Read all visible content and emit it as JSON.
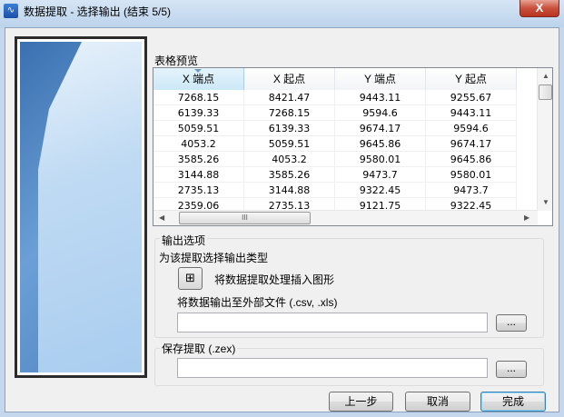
{
  "window": {
    "title": "数据提取 - 选择输出 (结束 5/5)",
    "close_label": "X"
  },
  "table_preview": {
    "label": "表格预览",
    "columns": [
      "X 端点",
      "X 起点",
      "Y 端点",
      "Y 起点"
    ],
    "rows": [
      [
        "7268.15",
        "8421.47",
        "9443.11",
        "9255.67"
      ],
      [
        "6139.33",
        "7268.15",
        "9594.6",
        "9443.11"
      ],
      [
        "5059.51",
        "6139.33",
        "9674.17",
        "9594.6"
      ],
      [
        "4053.2",
        "5059.51",
        "9645.86",
        "9674.17"
      ],
      [
        "3585.26",
        "4053.2",
        "9580.01",
        "9645.86"
      ],
      [
        "3144.88",
        "3585.26",
        "9473.7",
        "9580.01"
      ],
      [
        "2735.13",
        "3144.88",
        "9322.45",
        "9473.7"
      ],
      [
        "2359.06",
        "2735.13",
        "9121.75",
        "9322.45"
      ]
    ],
    "hscroll_grip": "III"
  },
  "output_options": {
    "group_label": "输出选项",
    "prompt": "为该提取选择输出类型",
    "insert_label": "将数据提取处理插入图形",
    "external_label": "将数据输出至外部文件 (.csv, .xls)",
    "external_value": "",
    "browse_label": "..."
  },
  "save_extract": {
    "group_label": "保存提取 (.zex)",
    "value": "",
    "browse_label": "..."
  },
  "footer": {
    "back": "上一步",
    "cancel": "取消",
    "finish": "完成"
  }
}
